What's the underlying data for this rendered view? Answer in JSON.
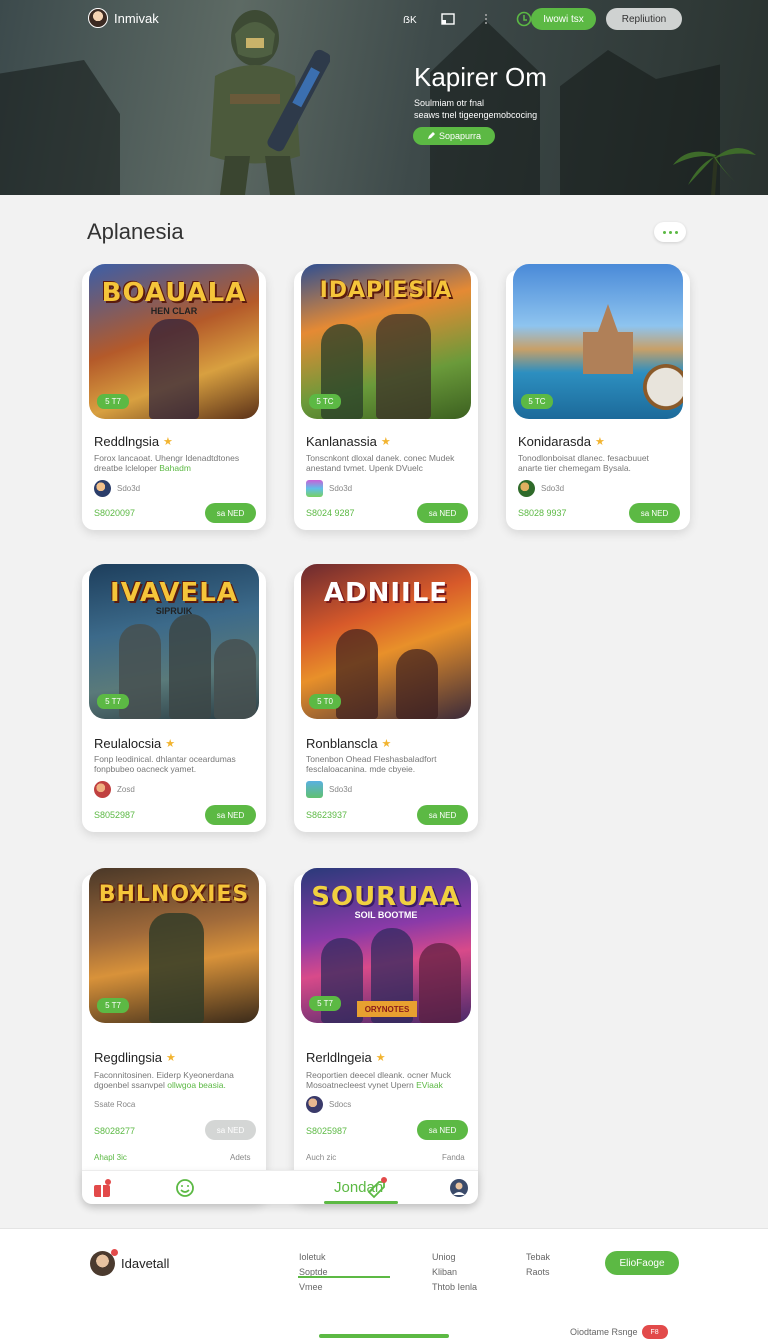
{
  "header": {
    "username": "Inmivak",
    "icons": [
      "translate-icon",
      "cast-icon",
      "menu-dots-icon",
      "refresh-icon"
    ],
    "primary_button": "Iwowi tsx",
    "secondary_button": "Repliution"
  },
  "hero": {
    "title": "Kapirer Om",
    "subtitle_line1": "Soulmiam otr fnal",
    "subtitle_line2": "seaws tnel tigeengemobcocing",
    "cta": "Sopapurra"
  },
  "section": {
    "title": "Aplanesia"
  },
  "cards": [
    {
      "art_title": "BOAUALA",
      "art_sub": "HEN CLAR",
      "tag": "5 T7",
      "name": "Reddlngsia",
      "desc_line1": "Forox lancaoat. Uhengr Idenadtdtones",
      "desc_line2": "dreatbe lcleloper",
      "desc_highlight": "Bahadm",
      "meta": "Sdo3d",
      "price": "S8020097",
      "buy": "sa NED",
      "buy_enabled": true
    },
    {
      "art_title": "IDAPIESIA",
      "art_sub": "",
      "tag": "5 TC",
      "name": "Kanlanassia",
      "desc_line1": "Tonscnkont dloxal danek. conec Mudek",
      "desc_line2": "anestand tvmet. Upenk DVuelc",
      "desc_highlight": "",
      "meta": "Sdo3d",
      "price": "S8024 9287",
      "buy": "sa NED",
      "buy_enabled": true
    },
    {
      "art_title": "",
      "art_sub": "",
      "tag": "5 TC",
      "name": "Konidarasda",
      "desc_line1": "Tonodlonboisat dlanec. fesacbuuet",
      "desc_line2": "anarte tier chemegam Bysala.",
      "desc_highlight": "",
      "meta": "Sdo3d",
      "price": "S8028 9937",
      "buy": "sa NED",
      "buy_enabled": true
    },
    {
      "art_title": "IVAVELA",
      "art_sub": "SIPRUIK",
      "tag": "5 T7",
      "name": "Reulalocsia",
      "desc_line1": "Fonp leodinical. dhlantar oceardumas",
      "desc_line2": "fonpbubeo oacneck yamet.",
      "desc_highlight": "",
      "meta": "Zosd",
      "price": "S8052987",
      "buy": "sa NED",
      "buy_enabled": true
    },
    {
      "art_title": "ADNIILE",
      "art_sub": "",
      "tag": "5 T0",
      "name": "Ronblanscla",
      "desc_line1": "Tonenbon Ohead Fleshasbaladfort",
      "desc_line2": "fesclaloacanina. mde cbyeie.",
      "desc_highlight": "",
      "meta": "Sdo3d",
      "price": "S8623937",
      "buy": "sa NED",
      "buy_enabled": true
    },
    {
      "art_title": "BHLNOXIES",
      "art_sub": "",
      "tag": "5 T7",
      "name": "Regdlingsia",
      "desc_line1": "Faconnitosinen. Eiderp Kyeonerdana",
      "desc_line2": "dgoenbel ssanvpel",
      "desc_highlight": "ollwgoa beasia.",
      "meta": "Ssate Roca",
      "price": "S8028277",
      "buy": "sa NED",
      "buy_enabled": false
    },
    {
      "art_title": "SOURUAA",
      "art_sub": "SOIL BOOTME",
      "tag": "5 T7",
      "name": "Rerldlngeia",
      "desc_line1": "Reoportien deecel dleank. ocner Muck",
      "desc_line2": "Mosoatnecleest vynet Upern",
      "desc_highlight": "EViaak",
      "meta": "Sdocs",
      "price": "S8025987",
      "buy": "sa NED",
      "buy_enabled": true,
      "banner": "ORYNOTES"
    }
  ],
  "card_links": {
    "left_a": "Ahapl 3ic",
    "left_b": "Adets",
    "right_a": "Auch zic",
    "right_b": "Fanda"
  },
  "tabbar": {
    "active_label": "Jondan",
    "icons": [
      "gift-icon",
      "smile-icon",
      "tag-icon",
      "profile-icon"
    ]
  },
  "footer": {
    "username": "Idavetall",
    "col1": [
      "Ioletuk",
      "Soptde",
      "Vmee"
    ],
    "col2": [
      "Uniog",
      "Kliban",
      "Thtob Ienla"
    ],
    "col3": [
      "Tebak",
      "Raots"
    ],
    "button": "ElioFaoge",
    "note": "Oiodtame Rsnge",
    "badge": "F8"
  },
  "colors": {
    "accent": "#5cb944",
    "badge": "#e24a4a",
    "star": "#f2b430"
  }
}
